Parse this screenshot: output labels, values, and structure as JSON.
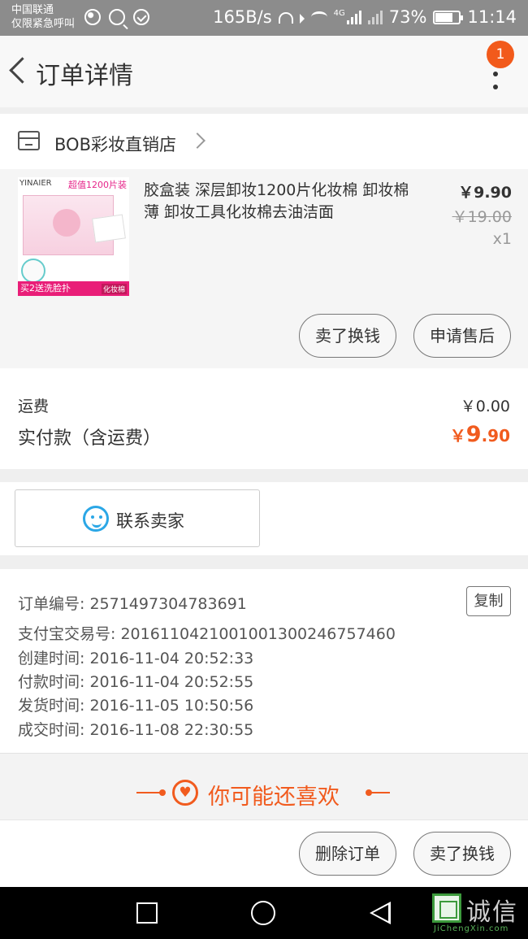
{
  "status_bar": {
    "carrier": "中国联通",
    "emergency": "仅限紧急呼叫",
    "net_speed": "165B/s",
    "network": "4G",
    "battery": "73%",
    "time": "11:14"
  },
  "header": {
    "title": "订单详情",
    "badge": "1"
  },
  "shop": {
    "name": "BOB彩妆直销店"
  },
  "product": {
    "thumb_brand": "YINAIER",
    "thumb_top": "超值1200片装",
    "thumb_bottom": "买2送洗脸扑",
    "thumb_tag": "化妆棉",
    "title": "胶盒装 深层卸妆1200片化妆棉 卸妆棉 薄 卸妆工具化妆棉去油洁面",
    "price": "￥9.90",
    "original_price": "￥19.00",
    "quantity": "x1",
    "buttons": {
      "resell": "卖了换钱",
      "after_sale": "申请售后"
    }
  },
  "totals": {
    "shipping_label": "运费",
    "shipping_value": "￥0.00",
    "paid_label": "实付款（含运费）",
    "paid_currency": "￥",
    "paid_int": "9",
    "paid_dec": ".90"
  },
  "contact": {
    "label": "联系卖家"
  },
  "order_info": {
    "copy_label": "复制",
    "rows": [
      {
        "label": "订单编号: ",
        "value": "2571497304783691"
      },
      {
        "label": "支付宝交易号: ",
        "value": "2016110421001001300246757460"
      },
      {
        "label": "创建时间: ",
        "value": "2016-11-04 20:52:33"
      },
      {
        "label": "付款时间: ",
        "value": "2016-11-04 20:52:55"
      },
      {
        "label": "发货时间: ",
        "value": "2016-11-05 10:50:56"
      },
      {
        "label": "成交时间: ",
        "value": "2016-11-08 22:30:55"
      }
    ]
  },
  "recommend": {
    "title": "你可能还喜欢"
  },
  "actions": {
    "delete": "删除订单",
    "resell": "卖了换钱"
  },
  "watermark": {
    "text": "诚信",
    "sub": "JiChengXin.com"
  },
  "colors": {
    "accent": "#f15b1e",
    "badge": "#f25a1b",
    "contact_icon": "#2ba7e6"
  }
}
